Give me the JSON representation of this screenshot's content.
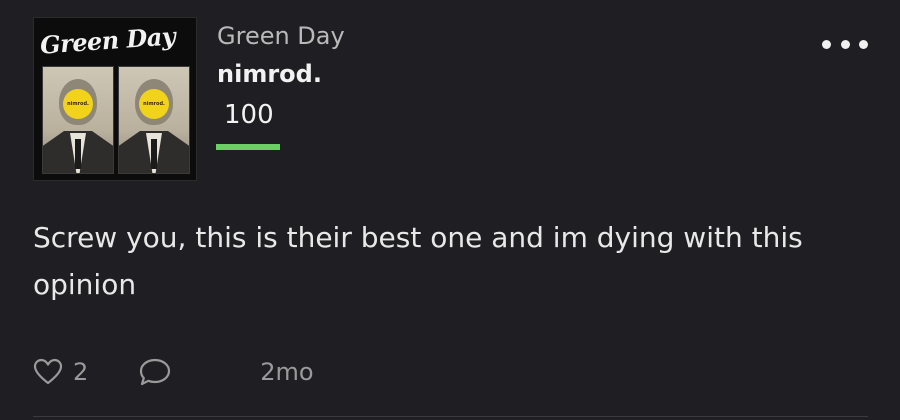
{
  "post": {
    "cover": {
      "band_text": "Green Day",
      "face_text": "nimrod."
    },
    "artist": "Green Day",
    "album": "nimrod.",
    "score": "100",
    "score_fraction": 1.0,
    "review_text": "Screw you, this is their best one and im dying with this opinion",
    "likes": "2",
    "time_ago": "2mo",
    "icons": {
      "menu": "more-horizontal-icon",
      "like": "heart-outline-icon",
      "comment": "comment-bubble-icon"
    },
    "colors": {
      "score_bar": "#6ccf63",
      "background": "#1f1f23"
    }
  }
}
